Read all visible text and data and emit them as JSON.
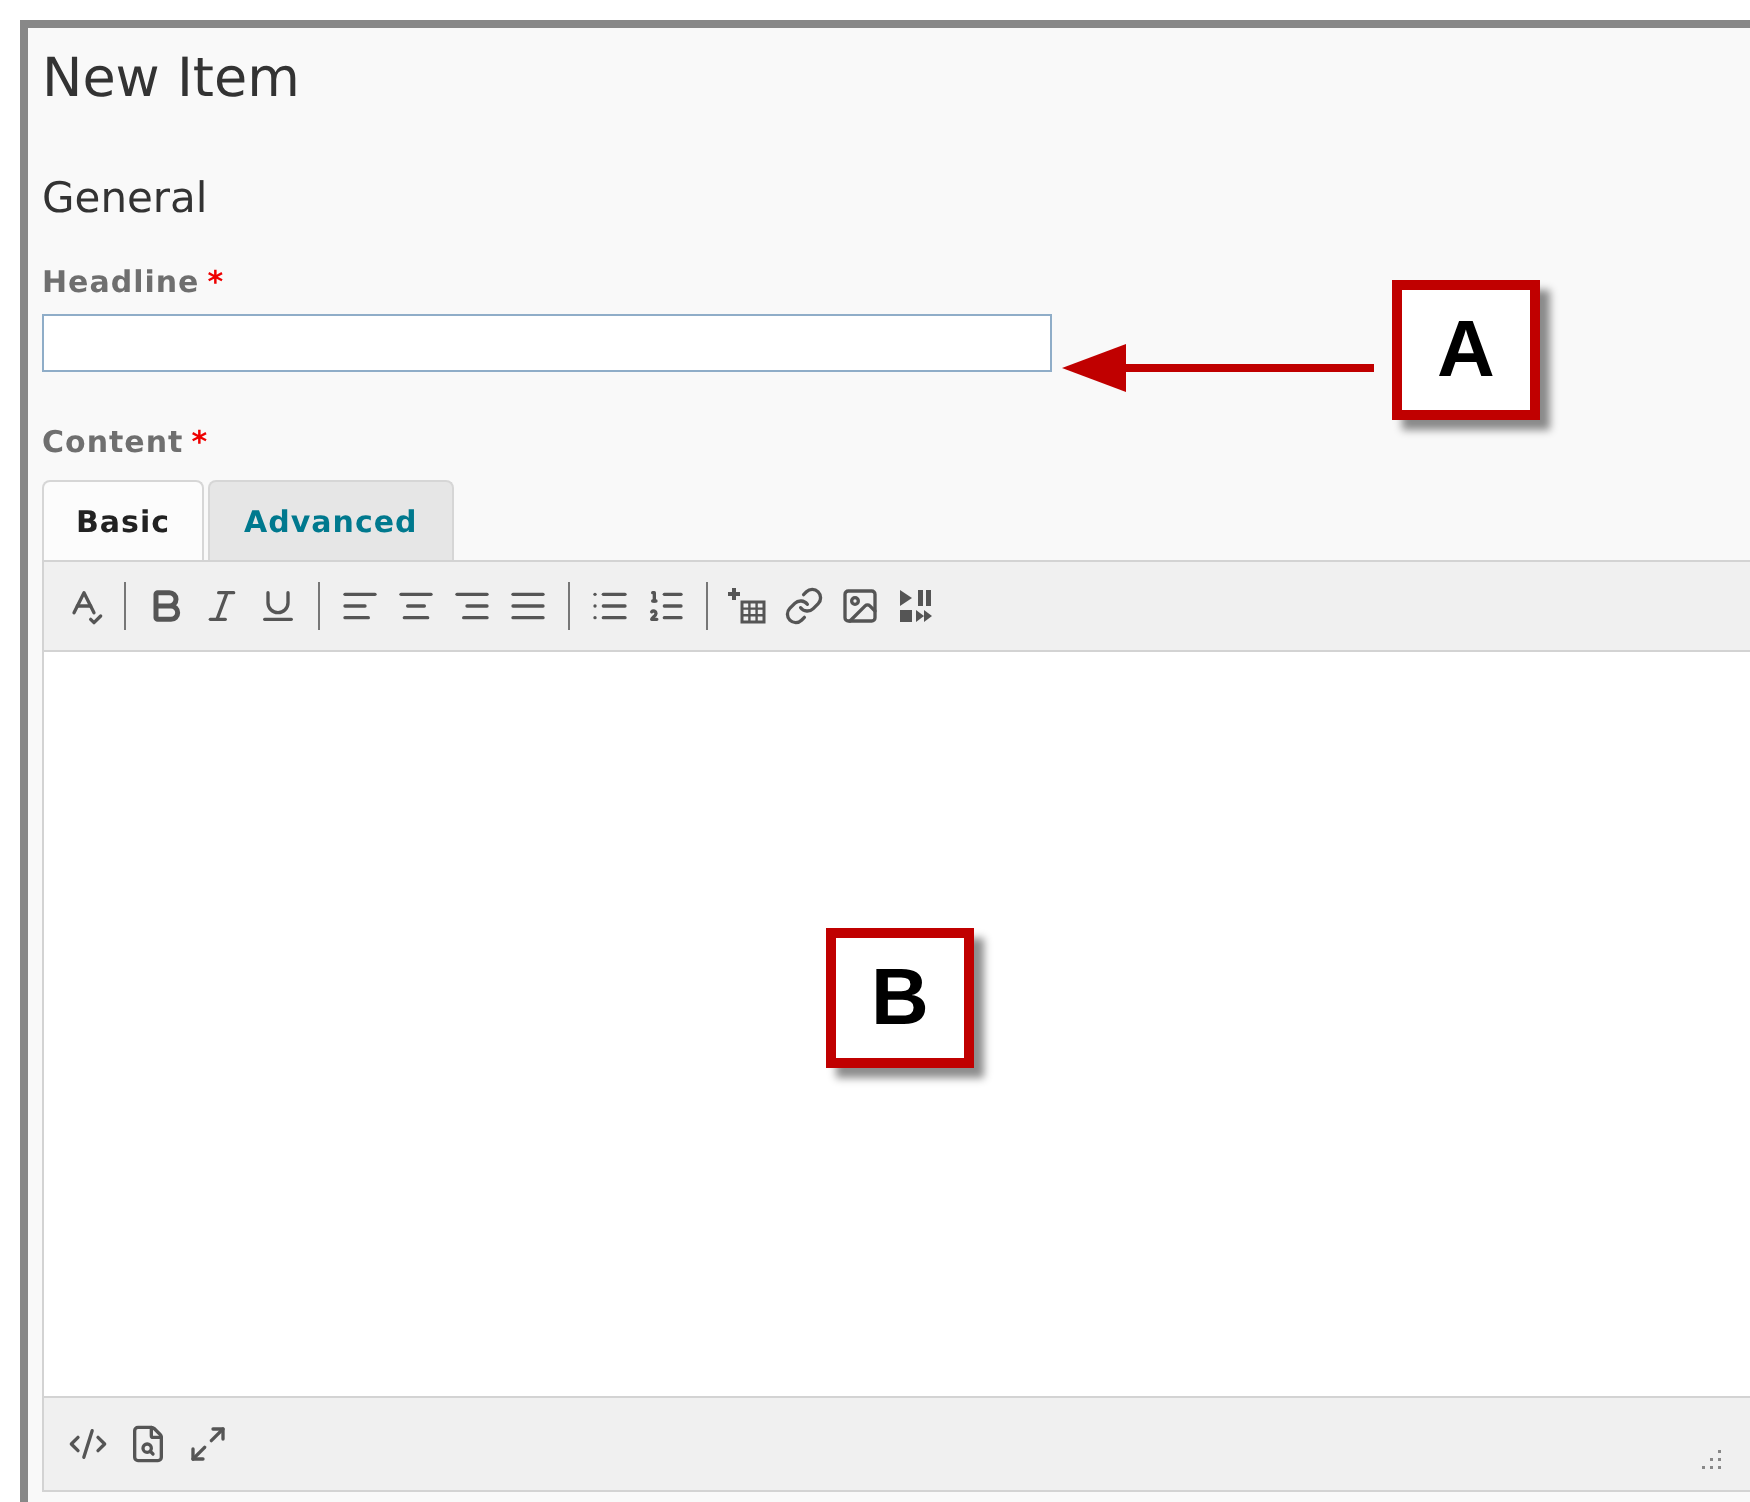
{
  "page": {
    "title": "New Item"
  },
  "section": {
    "title": "General"
  },
  "fields": [
    {
      "label": "Headline",
      "required_mark": "*",
      "kind": "text",
      "callout": "A"
    },
    {
      "label": "Content",
      "required_mark": "*",
      "kind": "editor",
      "callout": "B"
    }
  ],
  "editor_tabs": [
    {
      "label": "Basic",
      "selected": true
    },
    {
      "label": "Advanced",
      "selected": false
    }
  ]
}
